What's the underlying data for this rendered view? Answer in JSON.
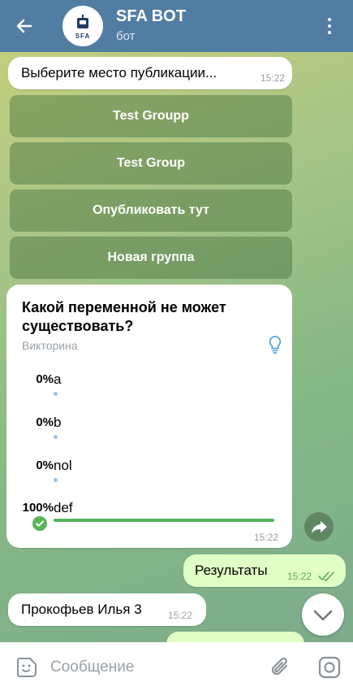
{
  "header": {
    "title": "SFA BOT",
    "subtitle": "бот",
    "avatar_text": "SFA"
  },
  "messages": {
    "choose_place": {
      "text": "Выберите место публикации...",
      "time": "15:22"
    },
    "keyboard": [
      "Test Groupp",
      "Test Group",
      "Опубликовать тут",
      "Новая группа"
    ],
    "poll": {
      "question": "Какой переменной не может существовать?",
      "kind": "Викторина",
      "options": [
        {
          "percent": "0%",
          "label": "a"
        },
        {
          "percent": "0%",
          "label": "b"
        },
        {
          "percent": "0%",
          "label": "nol"
        },
        {
          "percent": "100%",
          "label": "def"
        }
      ],
      "time": "15:22"
    },
    "results": {
      "text": "Результаты",
      "time": "15:22"
    },
    "name": {
      "text": "Прокофьев Илья 3",
      "time": "15:22"
    }
  },
  "input": {
    "placeholder": "Сообщение"
  },
  "colors": {
    "header": "#527da3",
    "accent": "#57b55a",
    "outgoing": "#e1fec6"
  }
}
